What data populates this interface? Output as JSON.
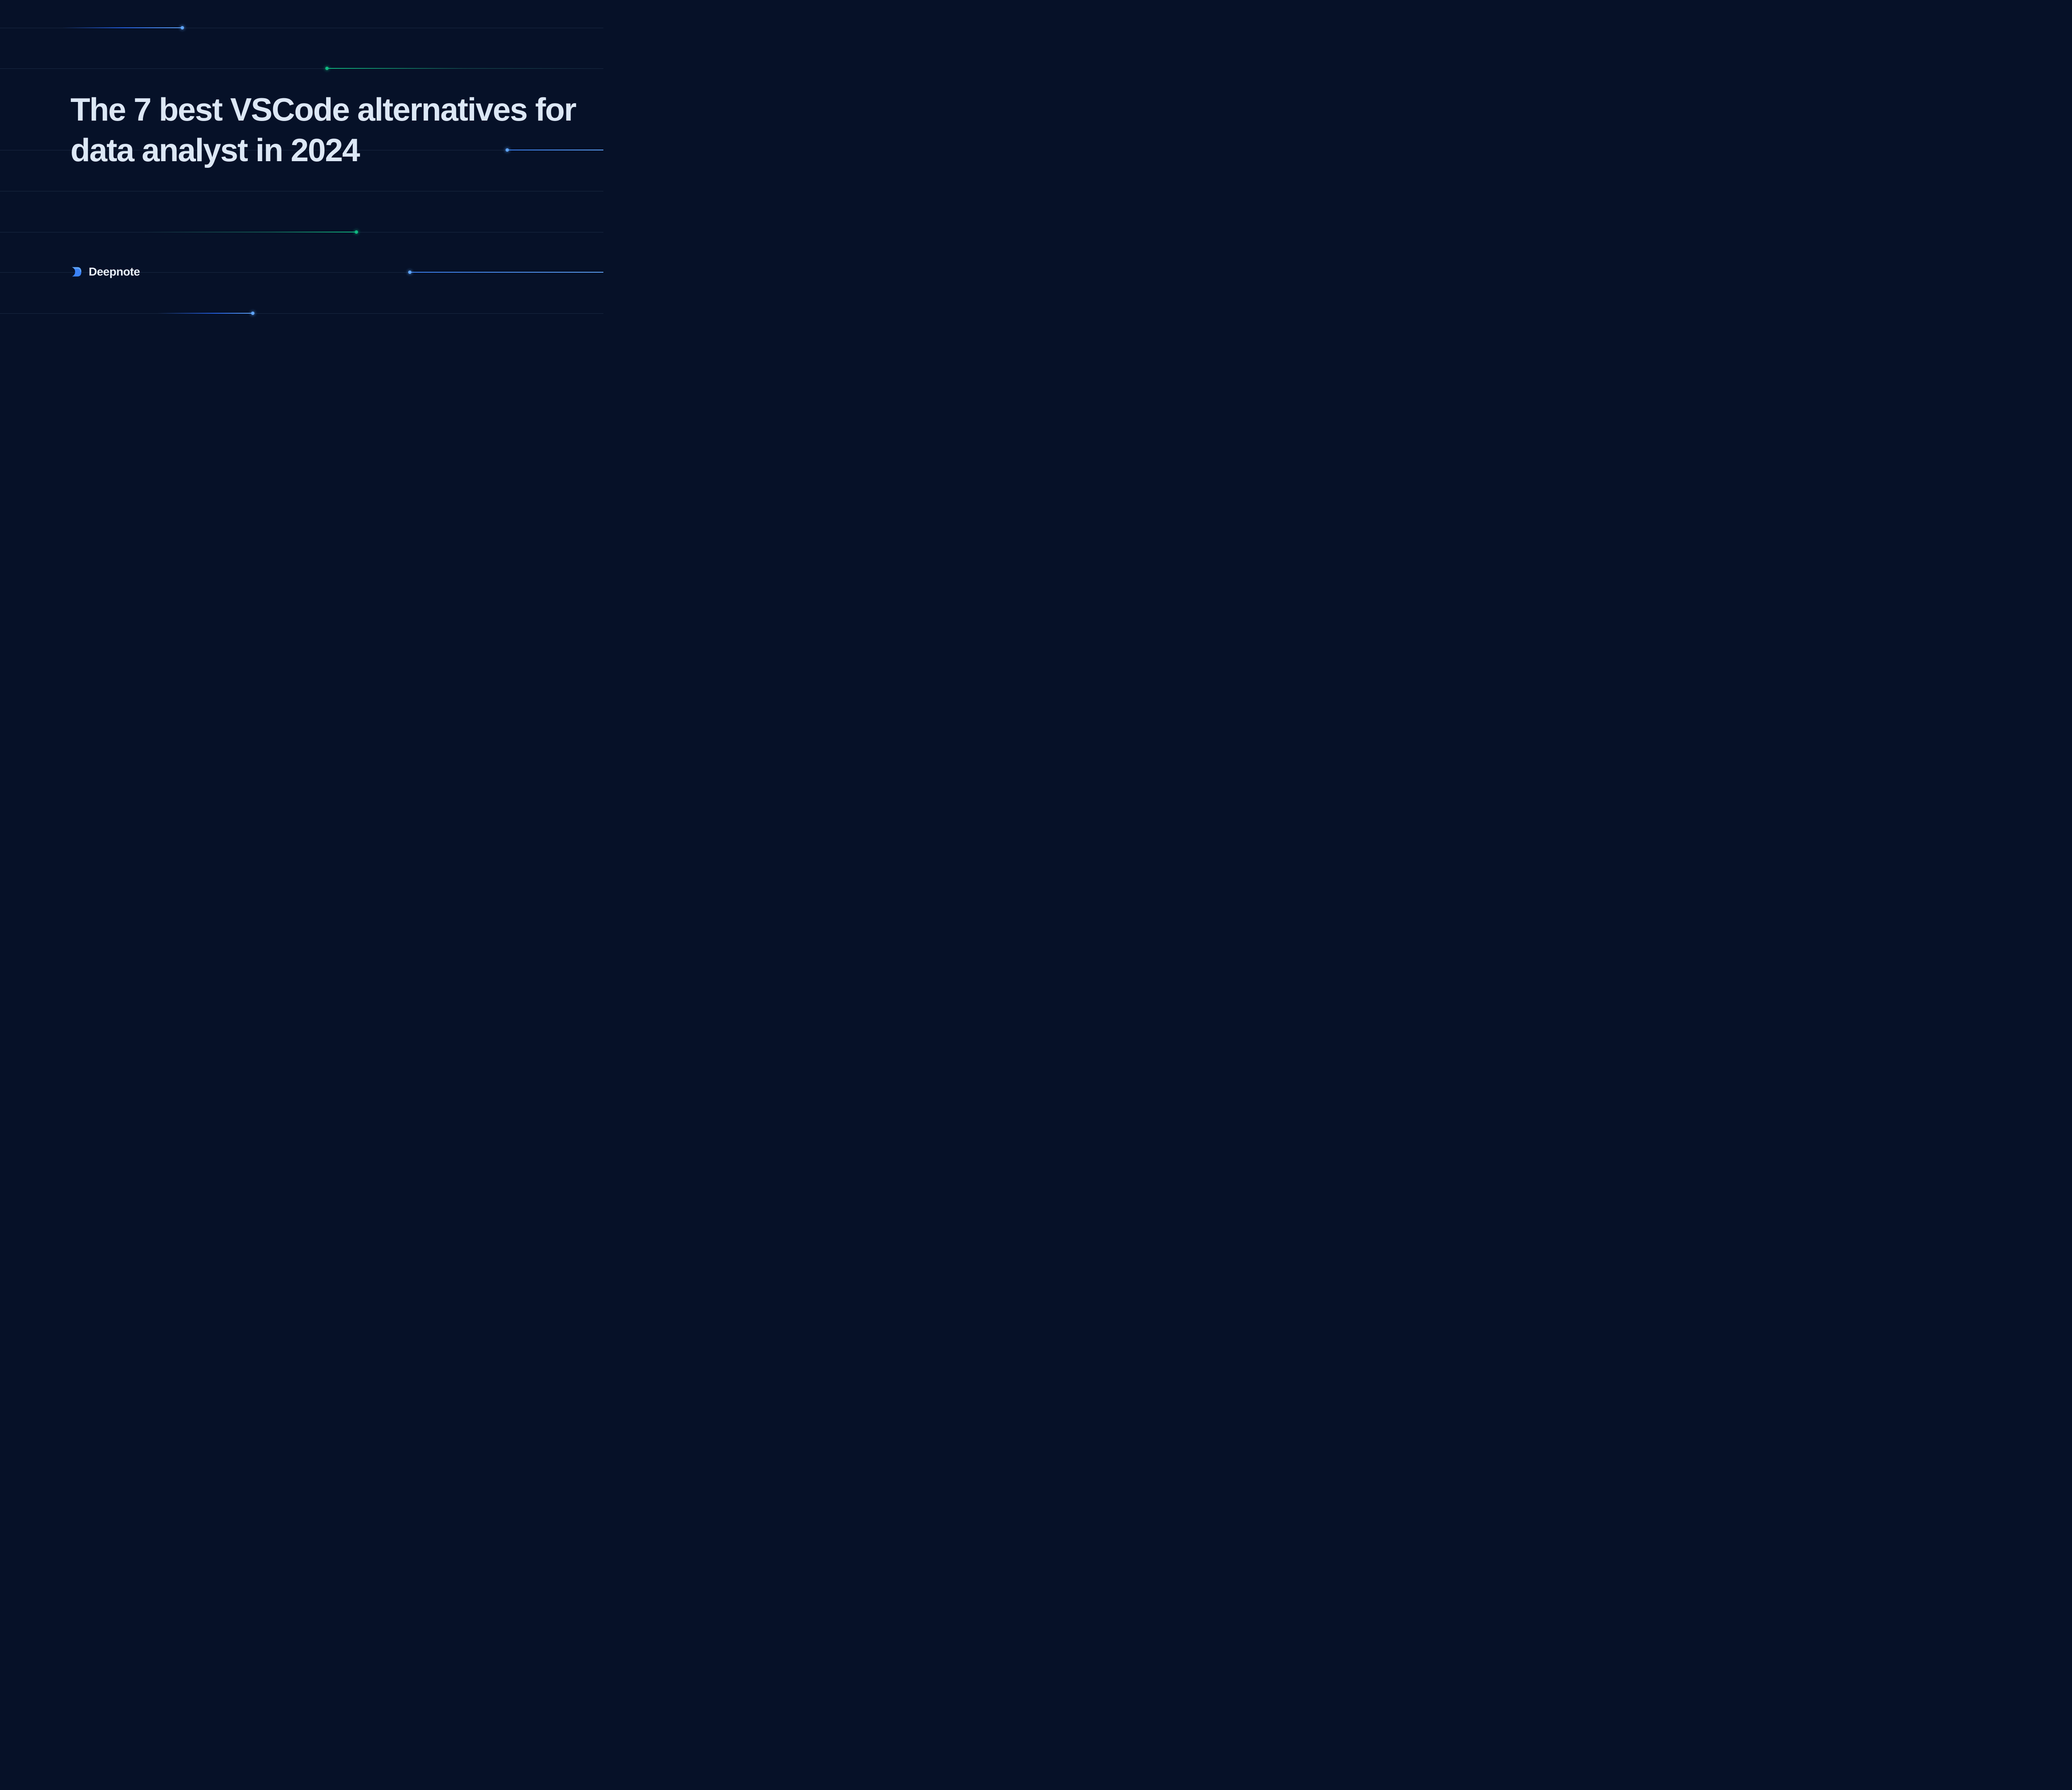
{
  "title": "The 7 best VSCode alternatives for data analyst in 2024",
  "brand": {
    "name": "Deepnote"
  }
}
